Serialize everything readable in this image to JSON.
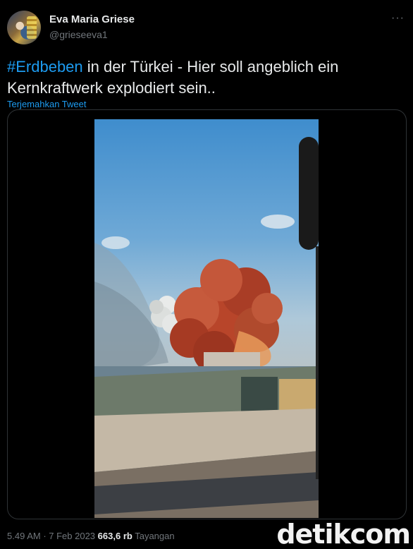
{
  "author": {
    "display_name": "Eva Maria Griese",
    "handle": "@grieseeva1"
  },
  "menu": {
    "more_label": "···"
  },
  "tweet": {
    "hashtag": "#Erdbeben",
    "text": " in der Türkei - Hier soll angeblich ein Kernkraftwerk explodiert sein..",
    "translate_label": "Terjemahkan Tweet"
  },
  "meta": {
    "time": "5.49 AM",
    "separator": " · ",
    "date": "7 Feb 2023",
    "views": "663,6 rb",
    "views_label": "Tayangan"
  },
  "watermark": {
    "text": "detikcom"
  },
  "colors": {
    "background": "#000000",
    "text": "#e7e9ea",
    "muted": "#71767b",
    "accent": "#1d9bf0",
    "border": "#2f3336",
    "smoke": "#b8452a"
  }
}
